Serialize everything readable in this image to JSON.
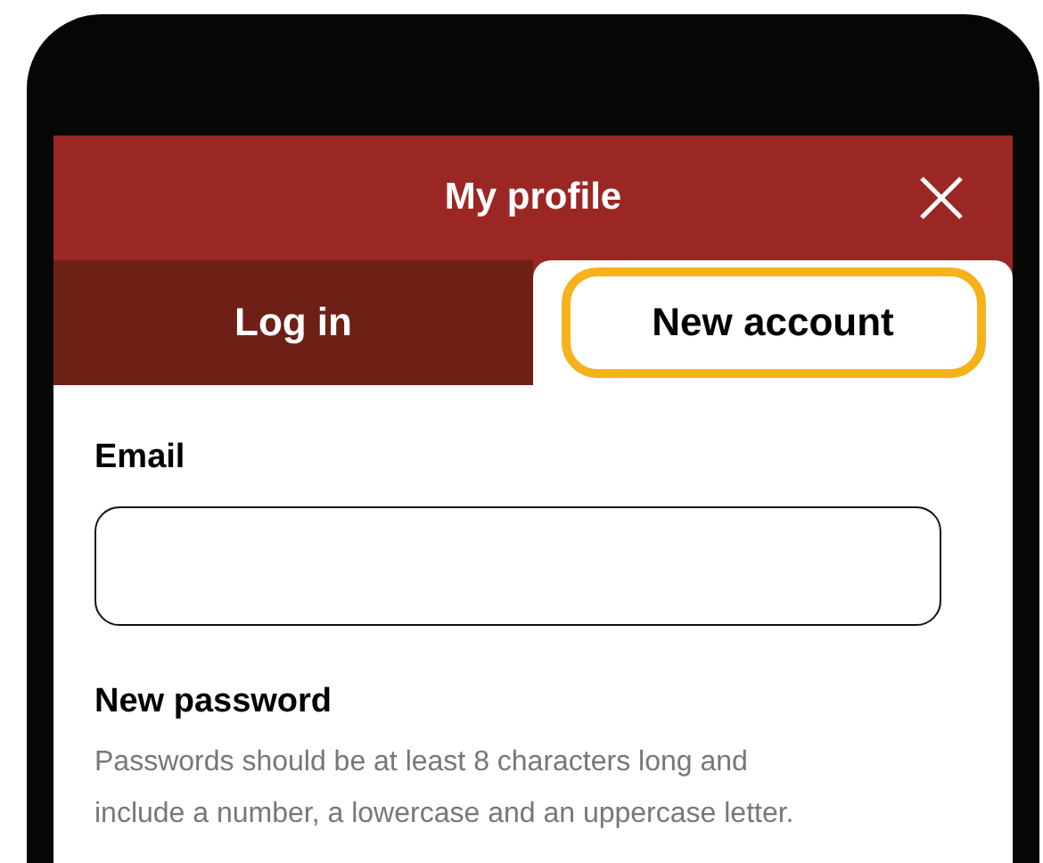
{
  "header": {
    "title": "My profile"
  },
  "tabs": [
    {
      "label": "Log in",
      "selected": false,
      "focused": false
    },
    {
      "label": "New account",
      "selected": true,
      "focused": true
    }
  ],
  "email": {
    "label": "Email"
  },
  "password": {
    "label": "New password",
    "hint": "Passwords should be at least 8 characters long and include a number, a lowercase and an uppercase letter."
  }
}
